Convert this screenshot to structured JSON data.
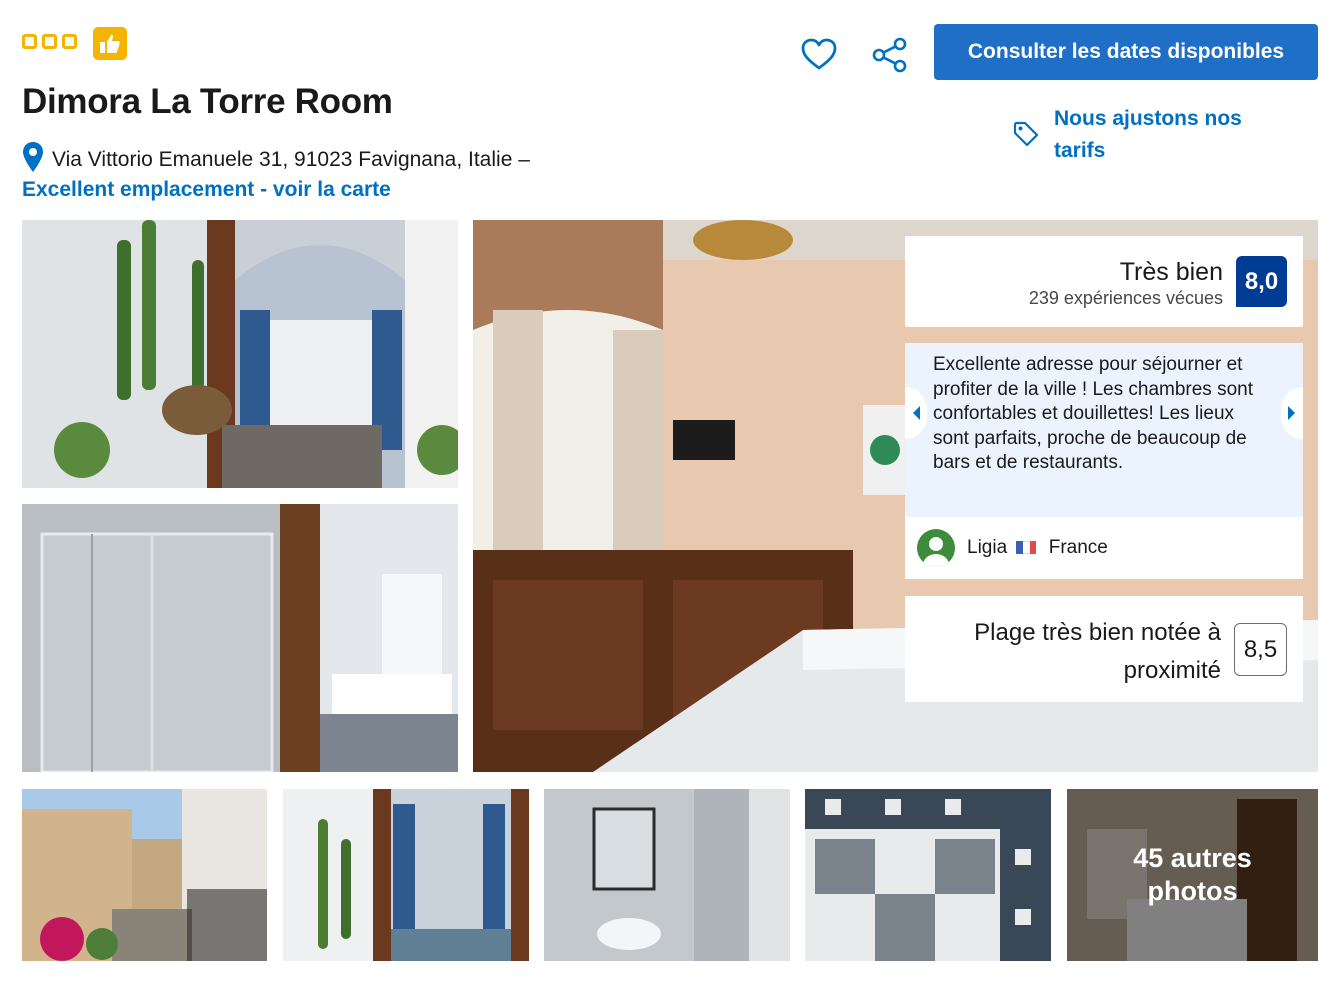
{
  "header": {
    "star_count": 3,
    "title": "Dimora La Torre Room",
    "address": "Via Vittorio Emanuele 31, 91023 Favignana, Italie –",
    "map_link": "Excellent emplacement - voir la carte",
    "cta_label": "Consulter les dates disponibles",
    "price_note": "Nous ajustons nos tarifs",
    "icons": [
      "thumbs-up-icon",
      "location-pin-icon",
      "heart-icon",
      "share-icon",
      "price-tag-icon"
    ]
  },
  "score": {
    "label": "Très bien",
    "reviews": "239 expériences vécues",
    "value": "8,0"
  },
  "review": {
    "text": "Excellente adresse pour séjourner et profiter de la ville ! Les chambres sont confortables et douillettes! Les lieux sont parfaits, proche de beaucoup de bars et de restaurants.",
    "author": "Ligia",
    "country": "France"
  },
  "beach": {
    "label": "Plage très bien notée à proximité",
    "value": "8,5"
  },
  "gallery": {
    "more_photos": "45 autres photos"
  },
  "colors": {
    "brand_blue": "#1f6fc6",
    "link_blue": "#0071c2",
    "score_navy": "#003b95",
    "star_yellow": "#f5b400",
    "review_bg": "#ebf3ff"
  }
}
